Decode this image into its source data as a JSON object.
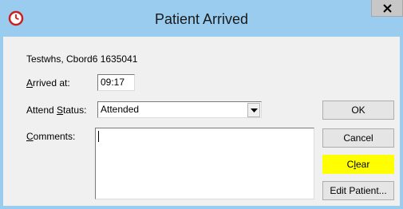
{
  "window": {
    "title": "Patient Arrived",
    "titlebar_color": "#99ccee",
    "icon": "clock-icon",
    "close_glyph": "x"
  },
  "patient": {
    "name_line": "Testwhs, Cbord6 1635041"
  },
  "arrived": {
    "label_prefix": "",
    "label_mnemonic": "A",
    "label_suffix": "rrived at:",
    "value": "09:17"
  },
  "attend": {
    "label_prefix": "Attend ",
    "label_mnemonic": "S",
    "label_suffix": "tatus:",
    "value": "Attended"
  },
  "comments": {
    "label_prefix": "",
    "label_mnemonic": "C",
    "label_suffix": "omments:",
    "value": ""
  },
  "buttons": {
    "ok": "OK",
    "cancel": "Cancel",
    "clear_prefix": "C",
    "clear_mnemonic": "l",
    "clear_suffix": "ear",
    "edit_patient": "Edit Patient..."
  },
  "highlight_color": "#ffff00"
}
